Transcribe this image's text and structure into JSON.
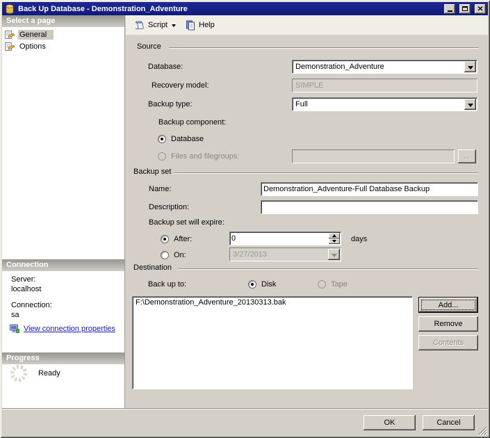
{
  "window": {
    "title": "Back Up Database - Demonstration_Adventure"
  },
  "toolbar": {
    "script": "Script",
    "help": "Help"
  },
  "sidebar": {
    "select_page_header": "Select a page",
    "pages": [
      {
        "label": "General"
      },
      {
        "label": "Options"
      }
    ],
    "connection": {
      "header": "Connection",
      "server_label": "Server:",
      "server_value": "localhost",
      "connection_label": "Connection:",
      "connection_value": "sa",
      "view_link": "View connection properties"
    },
    "progress": {
      "header": "Progress",
      "status": "Ready"
    }
  },
  "main": {
    "source": {
      "title": "Source",
      "database_label": "Database:",
      "database_value": "Demonstration_Adventure",
      "recovery_label": "Recovery model:",
      "recovery_value": "SIMPLE",
      "backup_type_label": "Backup type:",
      "backup_type_value": "Full",
      "component_label": "Backup component:",
      "database_radio": "Database",
      "files_radio": "Files and filegroups:",
      "browse_button": "..."
    },
    "backup_set": {
      "title": "Backup set",
      "name_label": "Name:",
      "name_value": "Demonstration_Adventure-Full Database Backup",
      "description_label": "Description:",
      "description_value": "",
      "expire_label": "Backup set will expire:",
      "after_radio": "After:",
      "after_value": "0",
      "days_label": "days",
      "on_radio": "On:",
      "on_value": "3/27/2013"
    },
    "destination": {
      "title": "Destination",
      "backup_to_label": "Back up to:",
      "disk_radio": "Disk",
      "tape_radio": "Tape",
      "files": [
        "F:\\Demonstration_Adventure_20130313.bak"
      ],
      "add_button": "Add...",
      "remove_button": "Remove",
      "contents_button": "Contents"
    }
  },
  "footer": {
    "ok": "OK",
    "cancel": "Cancel"
  },
  "colors": {
    "titlebar": "#101a7c",
    "link": "#1919cf"
  }
}
